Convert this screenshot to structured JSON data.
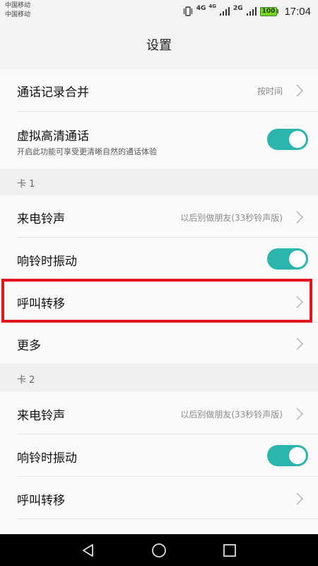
{
  "status_bar": {
    "carrier_1": "中国移动",
    "carrier_2": "中国移动",
    "net_1": "4G",
    "net_1_small": "4G",
    "net_2": "2G",
    "battery": "100",
    "time": "17:04",
    "icons": [
      "vibrate-icon",
      "signal-icon",
      "signal-icon",
      "battery-icon"
    ]
  },
  "title": "设置",
  "rows": {
    "call_log_merge": {
      "label": "通话记录合并",
      "value": "按时间"
    },
    "virtual_hd": {
      "label": "虚拟高清通话",
      "sub": "开启此功能可享受更清晰自然的通话体验",
      "toggle": "on"
    },
    "card1": {
      "header": "卡 1",
      "ringtone": {
        "label": "来电铃声",
        "value": "以后别做朋友(33秒铃声版)"
      },
      "vibrate": {
        "label": "响铃时振动",
        "toggle": "on"
      },
      "forward": {
        "label": "呼叫转移"
      },
      "more": {
        "label": "更多"
      }
    },
    "card2": {
      "header": "卡 2",
      "ringtone": {
        "label": "来电铃声",
        "value": "以后别做朋友(33秒铃声版)"
      },
      "vibrate": {
        "label": "响铃时振动",
        "toggle": "on"
      },
      "forward": {
        "label": "呼叫转移"
      }
    }
  },
  "colors": {
    "toggle_on": "#2bb5ad",
    "highlight": "#e0141c",
    "nav_bar": "#000000"
  },
  "nav": [
    "back-icon",
    "home-icon",
    "recents-icon"
  ]
}
